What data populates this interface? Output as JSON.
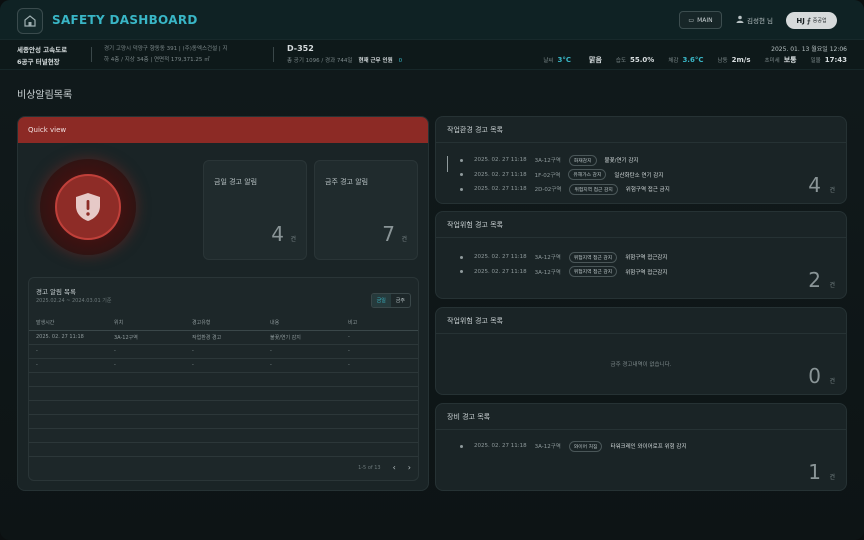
{
  "header": {
    "title": "SAFETY DASHBOARD",
    "main_button": "MAIN",
    "user": "김성현 님",
    "brand": "HJ",
    "brand_sub": "중공업"
  },
  "info": {
    "site_line1": "세종안성 고속도로",
    "site_line2": "6공구 터널현장",
    "addr_line1": "경기 고양시 덕양구 향동동 391 | (주)동엑스건설 | 지",
    "addr_line2": "하 4층 / 지상 34층 | 연면적 179,371.25 ㎡",
    "dday": "D-352",
    "dsub": "총 공기 1096 / 경과 744일",
    "workers_label": "현재 근무 인원",
    "workers_value": "0",
    "datetime": "2025. 01. 13 월요일 12:06",
    "weather": [
      {
        "label": "날씨",
        "value": "3°C",
        "cyan": true
      },
      {
        "label": "",
        "value": "맑음",
        "cyan": false
      },
      {
        "label": "습도",
        "value": "55.0%",
        "cyan": false
      },
      {
        "label": "체감",
        "value": "3.6°C",
        "cyan": true
      },
      {
        "label": "남동",
        "value": "2m/s",
        "cyan": false
      },
      {
        "label": "초미세",
        "value": "보통",
        "cyan": false
      },
      {
        "label": "일몰",
        "value": "17:43",
        "cyan": false
      }
    ]
  },
  "page_title": "비상알림목록",
  "quick_view": {
    "title": "Quick view",
    "today_label": "금일 경고 알림",
    "today_value": "4",
    "week_label": "금주 경고 알림",
    "week_value": "7",
    "unit": "건",
    "list": {
      "title": "경고 알림 목록",
      "subtitle": "2025.02.24 ~ 2024.03.01 기준",
      "tabs": [
        "금일",
        "금주"
      ],
      "columns": [
        "발생시간",
        "위치",
        "경고유형",
        "내용",
        "비고"
      ],
      "rows": [
        [
          "2025. 02. 27 11:18",
          "3A-12구역",
          "작업환경 경고",
          "불꽃/연기 감지",
          "-"
        ],
        [
          "-",
          "-",
          "-",
          "-",
          "-"
        ],
        [
          "-",
          "-",
          "-",
          "-",
          "-"
        ],
        [
          "",
          "",
          "",
          "",
          ""
        ],
        [
          "",
          "",
          "",
          "",
          ""
        ],
        [
          "",
          "",
          "",
          "",
          ""
        ],
        [
          "",
          "",
          "",
          "",
          ""
        ],
        [
          "",
          "",
          "",
          "",
          ""
        ],
        [
          "",
          "",
          "",
          "",
          ""
        ]
      ],
      "pager": "1-5 of 13"
    }
  },
  "panels": [
    {
      "title": "작업환경 경고 목록",
      "count": "4",
      "items": [
        {
          "time": "2025. 02. 27 11:18",
          "zone": "3A-12구역",
          "tag": "화재감지",
          "desc": "불꽃/연기 감지"
        },
        {
          "time": "2025. 02. 27 11:18",
          "zone": "1F-02구역",
          "tag": "유해가스 감지",
          "desc": "일산화탄소 연기 감지"
        },
        {
          "time": "2025. 02. 27 11:18",
          "zone": "2D-02구역",
          "tag": "위험지역 접근 감지",
          "desc": "위험구역 접근 금지"
        }
      ]
    },
    {
      "title": "작업위험 경고 목록",
      "count": "2",
      "items": [
        {
          "time": "2025. 02. 27 11:18",
          "zone": "3A-12구역",
          "tag": "위험지역 접근 감지",
          "desc": "위험구역 접근감지"
        },
        {
          "time": "2025. 02. 27 11:18",
          "zone": "3A-12구역",
          "tag": "위험지역 접근 감지",
          "desc": "위험구역 접근감지"
        }
      ]
    },
    {
      "title": "작업위험 경고 목록",
      "count": "0",
      "empty": "금주 경고내역이 없습니다.",
      "items": []
    },
    {
      "title": "장비 경고 목록",
      "count": "1",
      "items": [
        {
          "time": "2025. 02. 27 11:18",
          "zone": "3A-12구역",
          "tag": "와이어 처짐",
          "desc": "타워크레인 와이어로프 위험 감지"
        }
      ]
    }
  ],
  "unit": "건"
}
